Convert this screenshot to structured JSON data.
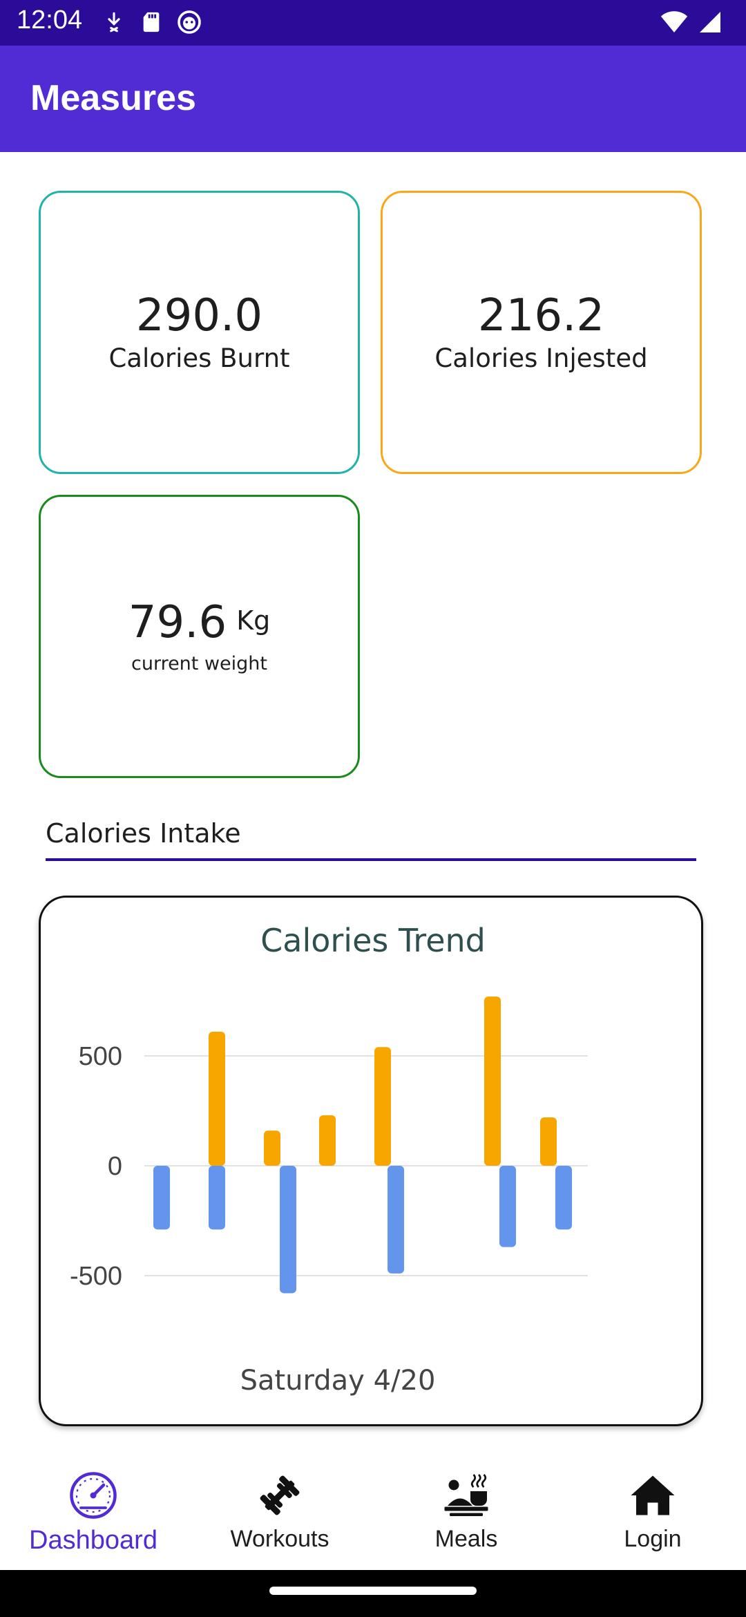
{
  "status_bar": {
    "time": "12:04",
    "left_icons": [
      "download-icon",
      "sd-card-icon",
      "notification-face-icon"
    ],
    "right_icons": [
      "wifi-icon",
      "cellular-signal-icon"
    ],
    "background_color": "#2a0c98"
  },
  "app_bar": {
    "title": "Measures",
    "background_color": "#512bd4"
  },
  "cards": {
    "calories_burnt": {
      "value": "290.0",
      "label": "Calories Burnt",
      "border_color": "#1fb3a9"
    },
    "calories_injested": {
      "value": "216.2",
      "label": "Calories Injested",
      "border_color": "#f7a81b"
    },
    "current_weight": {
      "value": "79.6",
      "unit": "Kg",
      "label": "current weight",
      "border_color": "#1a8a1a"
    }
  },
  "section": {
    "title": "Calories Intake"
  },
  "chart_data": {
    "type": "bar",
    "title": "Calories Trend",
    "xlabel": "Saturday 4/20",
    "ylabel": "",
    "ylim": [
      -700,
      800
    ],
    "yticks": [
      500,
      0,
      -500
    ],
    "grid": true,
    "legend": "none",
    "series": [
      {
        "color": "#f7a600",
        "values": [
          610,
          160,
          230,
          540,
          770,
          220
        ]
      },
      {
        "color": "#6495ed",
        "values": [
          -290,
          -290,
          -580,
          -490,
          -370,
          -290
        ]
      }
    ]
  },
  "bottom_nav": {
    "active_color": "#512bd4",
    "items": [
      {
        "label": "Dashboard",
        "icon": "speedometer-icon",
        "active": true
      },
      {
        "label": "Workouts",
        "icon": "dumbbell-icon",
        "active": false
      },
      {
        "label": "Meals",
        "icon": "meal-tray-icon",
        "active": false
      },
      {
        "label": "Login",
        "icon": "home-icon",
        "active": false
      }
    ]
  }
}
